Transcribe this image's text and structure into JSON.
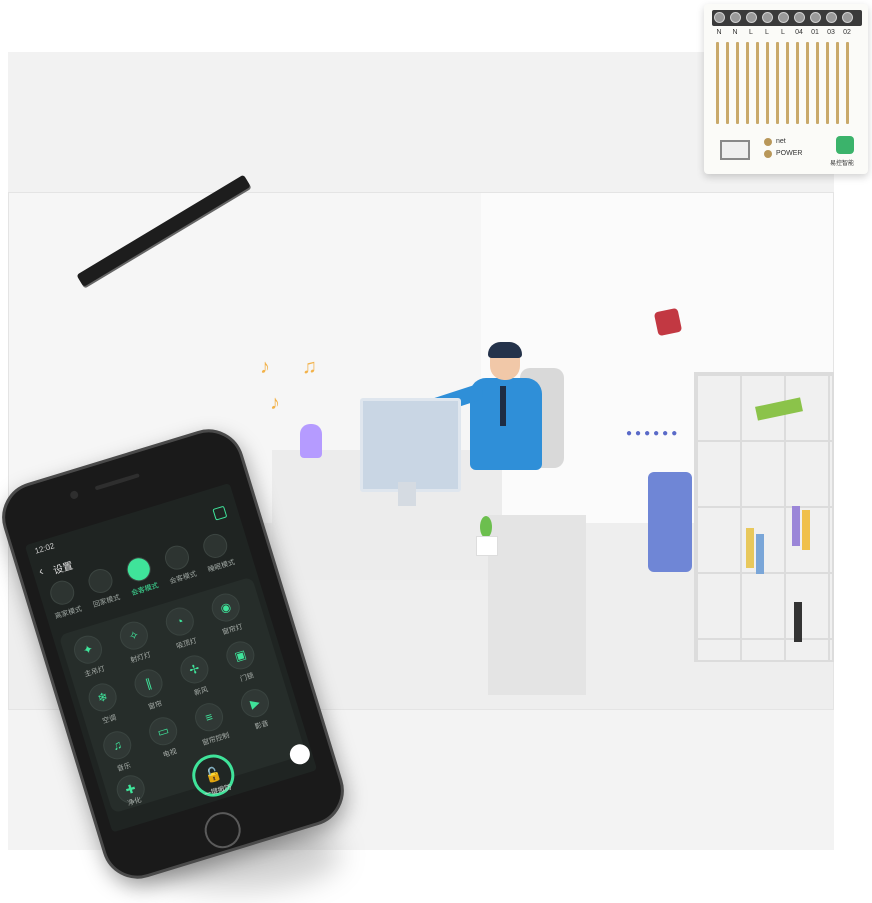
{
  "module": {
    "terminal_labels": [
      "N",
      "N",
      "L",
      "L",
      "L",
      "04",
      "01",
      "03",
      "02"
    ],
    "led_1": "net",
    "led_2": "POWER",
    "brand": "易控智能"
  },
  "phone": {
    "status_time": "12:02",
    "title": "设置",
    "scenes": [
      {
        "label": "离家模式",
        "active": false
      },
      {
        "label": "回家模式",
        "active": false
      },
      {
        "label": "会客模式",
        "active": true
      },
      {
        "label": "会客模式",
        "active": false
      },
      {
        "label": "睡眠模式",
        "active": false
      }
    ],
    "devices": [
      {
        "label": "主吊灯",
        "icon": "light-icon"
      },
      {
        "label": "射灯灯",
        "icon": "spotlight-icon"
      },
      {
        "label": "吸顶灯",
        "icon": "ceiling-icon"
      },
      {
        "label": "窗帘灯",
        "icon": "lamp-icon"
      },
      {
        "label": "空调",
        "icon": "ac-icon"
      },
      {
        "label": "窗帘",
        "icon": "curtain-icon"
      },
      {
        "label": "新风",
        "icon": "fan-icon"
      },
      {
        "label": "门锁",
        "icon": "lock-icon"
      },
      {
        "label": "音乐",
        "icon": "music-icon"
      },
      {
        "label": "电视",
        "icon": "tv-icon"
      },
      {
        "label": "窗帘控制",
        "icon": "blind-icon"
      },
      {
        "label": "影音",
        "icon": "media-icon"
      },
      {
        "label": "净化",
        "icon": "purifier-icon"
      }
    ],
    "lock_label": "一键撤防"
  },
  "colors": {
    "accent": "#3fe39a",
    "shirt": "#2f8fd8",
    "purifier": "#6f86d6"
  }
}
